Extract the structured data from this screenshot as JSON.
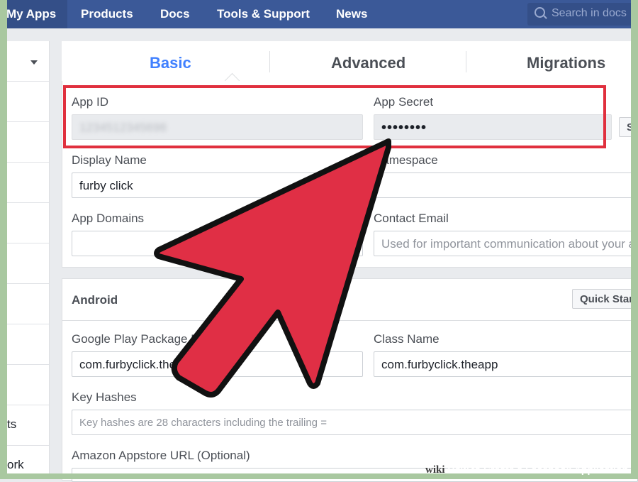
{
  "nav": {
    "items": [
      "My Apps",
      "Products",
      "Docs",
      "Tools & Support",
      "News"
    ],
    "search_placeholder": "Search in docs"
  },
  "sidebar": {
    "labels": [
      "ts",
      "ork"
    ]
  },
  "tabs": [
    "Basic",
    "Advanced",
    "Migrations"
  ],
  "basic": {
    "app_id_label": "App ID",
    "app_id_value": "1234512345698",
    "app_secret_label": "App Secret",
    "app_secret_value": "••••••••",
    "show_button": "S",
    "display_name_label": "Display Name",
    "display_name_value": "furby click",
    "namespace_label": "Namespace",
    "app_domains_label": "App Domains",
    "contact_email_label": "Contact Email",
    "contact_email_placeholder": "Used for important communication about your app"
  },
  "android": {
    "title": "Android",
    "quick_start_button": "Quick Start",
    "package_label": "Google Play Package Name",
    "package_value": "com.furbyclick.theapp",
    "class_label": "Class Name",
    "class_value": "com.furbyclick.theapp",
    "key_hashes_label": "Key Hashes",
    "key_hashes_placeholder": "Key hashes are 28 characters including the trailing =",
    "amazon_label": "Amazon Appstore URL (Optional)"
  },
  "footer": {
    "brand": "wiki",
    "title": "How to Create a Facebook Application"
  },
  "colors": {
    "topbar": "#3b5998",
    "active_tab": "#4080ff",
    "highlight": "#e0303e",
    "arrow_fill": "#e02f45"
  }
}
